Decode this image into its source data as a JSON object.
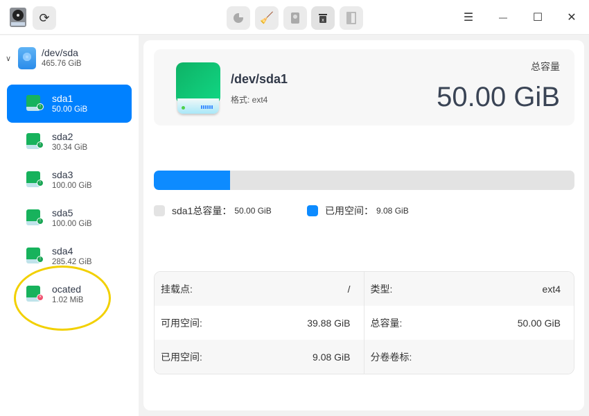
{
  "toolbar": {
    "app_icon": "disk-utility-icon",
    "refresh_icon": "refresh-icon",
    "actions": [
      "partition-pie-icon",
      "wipe-brush-icon",
      "mount-icon",
      "unmount-icon",
      "resize-icon"
    ],
    "window_controls": {
      "menu": "☰",
      "minimize": "—",
      "maximize": "☐",
      "close": "✕"
    }
  },
  "sidebar": {
    "disk": {
      "name": "/dev/sda",
      "size": "465.76 GiB"
    },
    "partitions": [
      {
        "name": "sda1",
        "size": "50.00 GiB",
        "status": "mounted"
      },
      {
        "name": "sda2",
        "size": "30.34 GiB",
        "status": "mounted"
      },
      {
        "name": "sda3",
        "size": "100.00 GiB",
        "status": "mounted"
      },
      {
        "name": "sda5",
        "size": "100.00 GiB",
        "status": "mounted"
      },
      {
        "name": "sda4",
        "size": "285.42 GiB",
        "status": "mounted"
      },
      {
        "name": "ocated",
        "size": "1.02 MiB",
        "status": "error"
      }
    ]
  },
  "main": {
    "title": "/dev/sda1",
    "format": "格式: ext4",
    "capacity_label": "总容量",
    "capacity": "50.00 GiB",
    "usage": {
      "used_fraction": 0.1816,
      "total_label": "sda1总容量：",
      "total_value": "50.00 GiB",
      "used_label": "已用空间：",
      "used_value": "9.08 GiB",
      "used_color": "#0d8bff",
      "free_color": "#e3e3e3"
    },
    "details": [
      [
        {
          "label": "挂载点:",
          "value": "/"
        },
        {
          "label": "类型:",
          "value": "ext4"
        }
      ],
      [
        {
          "label": "可用空间:",
          "value": "39.88 GiB"
        },
        {
          "label": "总容量:",
          "value": "50.00 GiB"
        }
      ],
      [
        {
          "label": "已用空间:",
          "value": "9.08 GiB"
        },
        {
          "label": "分卷卷标:",
          "value": ""
        }
      ]
    ]
  }
}
